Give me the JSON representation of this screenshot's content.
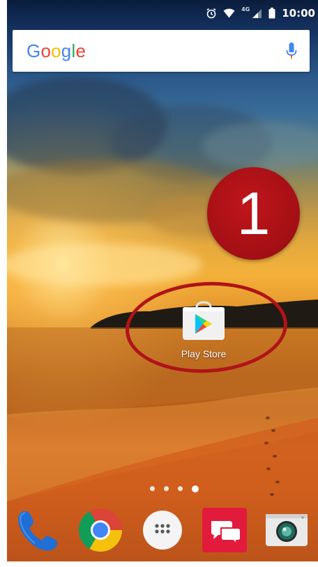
{
  "status_bar": {
    "time": "10:00",
    "network_label": "4G",
    "icons": [
      "alarm-icon",
      "wifi-icon",
      "signal-icon",
      "battery-icon"
    ]
  },
  "search": {
    "logo_text": "Google",
    "logo_colors": [
      "#4285F4",
      "#EA4335",
      "#FBBC05",
      "#4285F4",
      "#34A853",
      "#EA4335"
    ],
    "mic_icon": "mic-icon"
  },
  "annotation": {
    "badge_number": "1",
    "badge_color": "#a8121a",
    "ring_color": "#b01319"
  },
  "home": {
    "apps": [
      {
        "label": "Play Store",
        "icon": "play-store-icon"
      }
    ]
  },
  "page_indicator": {
    "count": 4,
    "active_index": 3
  },
  "dock": {
    "items": [
      {
        "icon": "phone-icon"
      },
      {
        "icon": "chrome-icon"
      },
      {
        "icon": "app-drawer-icon"
      },
      {
        "icon": "messenger-icon"
      },
      {
        "icon": "camera-icon"
      }
    ]
  }
}
